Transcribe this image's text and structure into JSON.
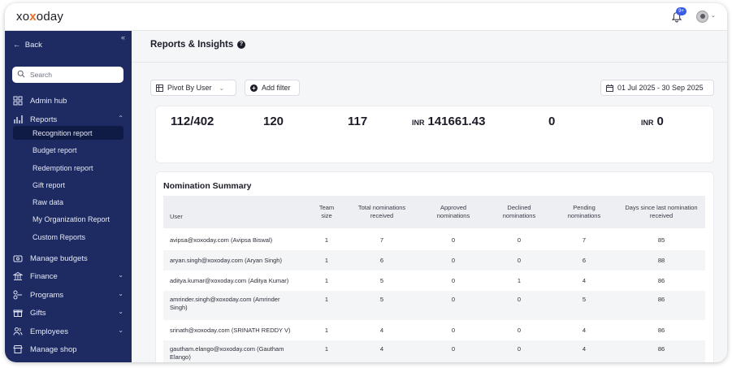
{
  "app": {
    "logo": "xoxoday",
    "notification_count": "9+"
  },
  "sidebar": {
    "back_label": "Back",
    "search_placeholder": "Search",
    "admin_hub": "Admin hub",
    "reports": "Reports",
    "reports_sub": [
      "Recognition report",
      "Budget report",
      "Redemption report",
      "Gift report",
      "Raw data",
      "My Organization Report",
      "Custom Reports"
    ],
    "manage_budgets": "Manage budgets",
    "finance": "Finance",
    "programs": "Programs",
    "gifts": "Gifts",
    "employees": "Employees",
    "manage_shop": "Manage shop"
  },
  "page": {
    "title": "Reports & Insights"
  },
  "filters": {
    "pivot_label": "Pivot By User",
    "add_filter_label": "Add filter",
    "date_range": "01 Jul 2025 - 30 Sep 2025"
  },
  "stats": {
    "s1": "112/402",
    "s2": "120",
    "s3": "117",
    "s4_currency": "INR",
    "s4": "141661.43",
    "s5": "0",
    "s6_currency": "INR",
    "s6": "0"
  },
  "summary": {
    "title": "Nomination Summary",
    "headers": {
      "user": "User",
      "team_size": [
        "Team",
        "size"
      ],
      "total": [
        "Total nominations",
        "received"
      ],
      "approved": [
        "Approved",
        "nominations"
      ],
      "declined": [
        "Declined",
        "nominations"
      ],
      "pending": [
        "Pending",
        "nominations"
      ],
      "days": [
        "Days since last nomination",
        "received"
      ]
    },
    "rows": [
      {
        "user": [
          "avipsa@xoxoday.com (Avipsa Biswal)"
        ],
        "team": "1",
        "total": "7",
        "approved": "0",
        "declined": "0",
        "pending": "7",
        "days": "85"
      },
      {
        "user": [
          "aryan.singh@xoxoday.com (Aryan Singh)"
        ],
        "team": "1",
        "total": "6",
        "approved": "0",
        "declined": "0",
        "pending": "6",
        "days": "88"
      },
      {
        "user": [
          "aditya.kumar@xoxoday.com (Aditya Kumar)"
        ],
        "team": "1",
        "total": "5",
        "approved": "0",
        "declined": "1",
        "pending": "4",
        "days": "86"
      },
      {
        "user": [
          "amrinder.singh@xoxoday.com (Amrinder",
          "Singh)"
        ],
        "team": "1",
        "total": "5",
        "approved": "0",
        "declined": "0",
        "pending": "5",
        "days": "86"
      },
      {
        "user": [
          "srinath@xoxoday.com (SRINATH REDDY V)"
        ],
        "team": "1",
        "total": "4",
        "approved": "0",
        "declined": "0",
        "pending": "4",
        "days": "86"
      },
      {
        "user": [
          "gautham.elango@xoxoday.com (Gautham",
          "Elango)"
        ],
        "team": "1",
        "total": "4",
        "approved": "0",
        "declined": "0",
        "pending": "4",
        "days": "86"
      }
    ]
  },
  "colors": {
    "sidebar_bg": "#1d2b62",
    "sidebar_active": "#0f1a45",
    "badge": "#3b5ce4",
    "logo_accent": "#f36b21"
  }
}
